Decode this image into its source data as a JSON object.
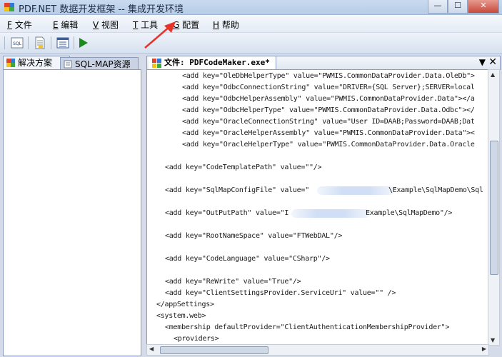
{
  "window": {
    "title": "PDF.NET 数据开发框架 -- 集成开发环境",
    "minimize": "—",
    "maximize": "☐",
    "close": "✕"
  },
  "menu": [
    {
      "key": "F",
      "label": "文件"
    },
    {
      "key": "E",
      "label": "编辑"
    },
    {
      "key": "V",
      "label": "视图"
    },
    {
      "key": "T",
      "label": "工具"
    },
    {
      "key": "G",
      "label": "配置"
    },
    {
      "key": "H",
      "label": "帮助"
    }
  ],
  "toolbar": {
    "icons": [
      "sql-icon",
      "document-icon",
      "list-view-icon",
      "run-icon"
    ]
  },
  "left_panel": {
    "tabs": [
      {
        "label": "解决方案",
        "active": true
      },
      {
        "label": "SQL-MAP资源",
        "active": false
      }
    ]
  },
  "editor": {
    "tab_title": "文件: PDFCodeMaker.exe*",
    "lines": [
      "<add key=\"OleDbHelperType\" value=\"PWMIS.CommonDataProvider.Data.OleDb\">",
      "<add key=\"OdbcConnectionString\" value=\"DRIVER={SQL Server};SERVER=local",
      "<add key=\"OdbcHelperAssembly\" value=\"PWMIS.CommonDataProvider.Data\"></a",
      "<add key=\"OdbcHelperType\" value=\"PWMIS.CommonDataProvider.Data.Odbc\"></",
      "<add key=\"OracleConnectionString\" value=\"User ID=DAAB;Password=DAAB;Dat",
      "<add key=\"OracleHelperAssembly\" value=\"PWMIS.CommonDataProvider.Data\"><",
      "<add key=\"OracleHelperType\" value=\"PWMIS.CommonDataProvider.Data.Oracle",
      "<add key=\"CodeTemplatePath\" value=\"\"/>",
      "<add key=\"SqlMapConfigFile\" value=\"",
      "\\Example\\SqlMapDemo\\Sql",
      "<add key=\"OutPutPath\" value=\"I",
      "Example\\SqlMapDemo\"/>",
      "<add key=\"RootNameSpace\" value=\"FTWebDAL\"/>",
      "<add key=\"CodeLanguage\" value=\"CSharp\"/>",
      "<add key=\"ReWrite\" value=\"True\"/>",
      "<add key=\"ClientSettingsProvider.ServiceUri\" value=\"\" />",
      "</appSettings>",
      "<system.web>",
      "<membership defaultProvider=\"ClientAuthenticationMembershipProvider\">",
      "<providers>"
    ]
  },
  "colors": {
    "background": "#d6dbe9",
    "arrow": "#e8332a",
    "run": "#1a8a1a"
  }
}
